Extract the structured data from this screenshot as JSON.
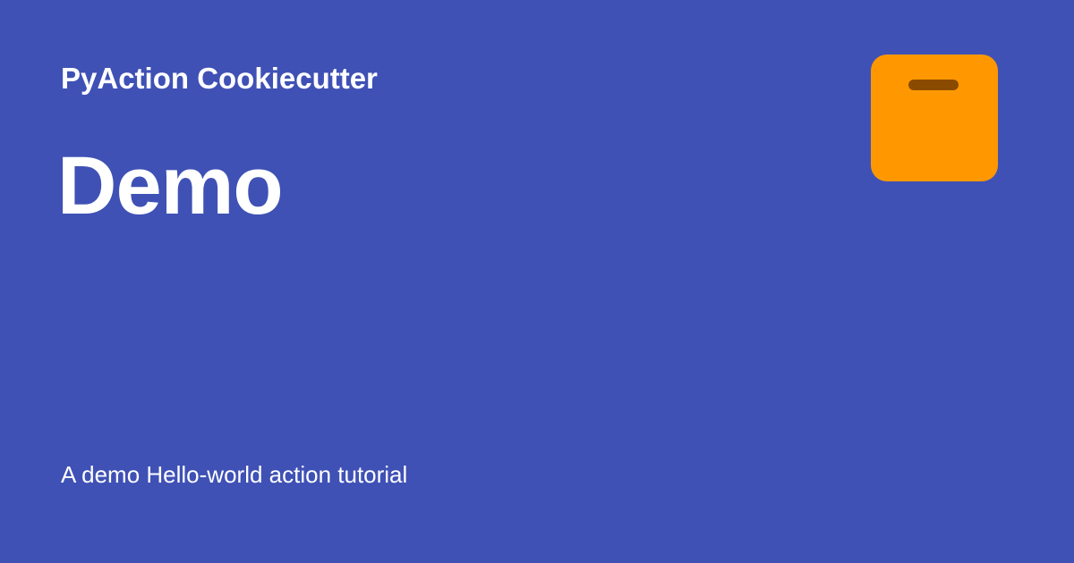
{
  "site_name": "PyAction Cookiecutter",
  "page_title": "Demo",
  "description": "A demo Hello-world action tutorial",
  "logo": {
    "icon": "archive-box-icon",
    "color": "#ff9800",
    "accent_color": "#8a4b00"
  },
  "colors": {
    "background": "#3f51b5",
    "text": "#ffffff"
  }
}
